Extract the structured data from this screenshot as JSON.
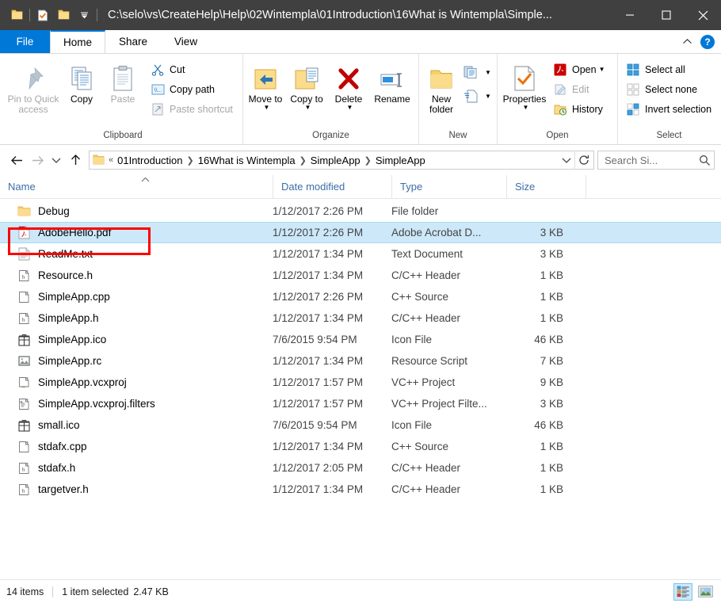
{
  "window": {
    "title": "C:\\selo\\vs\\CreateHelp\\Help\\02Wintempla\\01Introduction\\16What is Wintempla\\Simple...",
    "quick_access": [
      "folder-icon",
      "properties-check-icon",
      "new-folder-icon",
      "chevron-down-icon"
    ],
    "controls": {
      "minimize": "minimize-icon",
      "maximize": "maximize-icon",
      "close": "close-icon"
    }
  },
  "ribbon": {
    "tabs": [
      {
        "label": "File",
        "id": "file"
      },
      {
        "label": "Home",
        "id": "home"
      },
      {
        "label": "Share",
        "id": "share"
      },
      {
        "label": "View",
        "id": "view"
      }
    ],
    "active_tab": "Home",
    "collapse_icon": "chevron-up-icon",
    "help_label": "?",
    "groups": [
      {
        "label": "Clipboard",
        "big_buttons": [
          {
            "label": "Pin to Quick access",
            "icon": "pin-icon",
            "disabled": true
          },
          {
            "label": "Copy",
            "icon": "copy-icon",
            "disabled": false
          },
          {
            "label": "Paste",
            "icon": "paste-icon",
            "disabled": true
          }
        ],
        "small_buttons": [
          {
            "label": "Cut",
            "icon": "scissors-icon",
            "disabled": false
          },
          {
            "label": "Copy path",
            "icon": "copy-path-icon",
            "disabled": false
          },
          {
            "label": "Paste shortcut",
            "icon": "paste-shortcut-icon",
            "disabled": true
          }
        ]
      },
      {
        "label": "Organize",
        "big_buttons": [
          {
            "label": "Move to",
            "icon": "move-to-icon",
            "dropdown": true
          },
          {
            "label": "Copy to",
            "icon": "copy-to-icon",
            "dropdown": true
          },
          {
            "label": "Delete",
            "icon": "delete-x-icon",
            "dropdown": true
          },
          {
            "label": "Rename",
            "icon": "rename-icon",
            "dropdown": false
          }
        ]
      },
      {
        "label": "New",
        "big_buttons": [
          {
            "label": "New folder",
            "icon": "new-folder-icon"
          }
        ],
        "small_buttons": [
          {
            "label": "",
            "icon": "new-item-icon",
            "dropdown": true
          },
          {
            "label": "",
            "icon": "easy-access-icon",
            "dropdown": true
          }
        ]
      },
      {
        "label": "Open",
        "big_buttons": [
          {
            "label": "Properties",
            "icon": "properties-check-icon",
            "dropdown": true
          }
        ],
        "small_buttons": [
          {
            "label": "Open",
            "icon": "adobe-acrobat-icon",
            "dropdown": true,
            "disabled": false
          },
          {
            "label": "Edit",
            "icon": "edit-icon",
            "disabled": true
          },
          {
            "label": "History",
            "icon": "history-icon",
            "disabled": false
          }
        ]
      },
      {
        "label": "Select",
        "small_buttons": [
          {
            "label": "Select all",
            "icon": "select-all-icon"
          },
          {
            "label": "Select none",
            "icon": "select-none-icon"
          },
          {
            "label": "Invert selection",
            "icon": "invert-selection-icon"
          }
        ]
      }
    ]
  },
  "navigation": {
    "back": "back-arrow-icon",
    "forward": "forward-arrow-icon",
    "recent": "chevron-down-icon",
    "up": "up-arrow-icon",
    "breadcrumb_overflow": "«",
    "breadcrumbs": [
      "01Introduction",
      "16What is Wintempla",
      "SimpleApp",
      "SimpleApp"
    ],
    "address_dropdown": "chevron-down-icon",
    "refresh": "refresh-icon",
    "search_placeholder": "Search Si...",
    "search_icon": "search-icon"
  },
  "columns": [
    {
      "label": "Name",
      "sorted": "asc"
    },
    {
      "label": "Date modified"
    },
    {
      "label": "Type"
    },
    {
      "label": "Size"
    }
  ],
  "files": [
    {
      "name": "Debug",
      "date": "1/12/2017 2:26 PM",
      "type": "File folder",
      "size": "",
      "icon": "folder-icon",
      "selected": false
    },
    {
      "name": "AdobeHello.pdf",
      "date": "1/12/2017 2:26 PM",
      "type": "Adobe Acrobat D...",
      "size": "3 KB",
      "icon": "pdf-icon",
      "selected": true
    },
    {
      "name": "ReadMe.txt",
      "date": "1/12/2017 1:34 PM",
      "type": "Text Document",
      "size": "3 KB",
      "icon": "text-icon",
      "selected": false
    },
    {
      "name": "Resource.h",
      "date": "1/12/2017 1:34 PM",
      "type": "C/C++ Header",
      "size": "1 KB",
      "icon": "header-icon",
      "selected": false
    },
    {
      "name": "SimpleApp.cpp",
      "date": "1/12/2017 2:26 PM",
      "type": "C++ Source",
      "size": "1 KB",
      "icon": "cpp-icon",
      "selected": false
    },
    {
      "name": "SimpleApp.h",
      "date": "1/12/2017 1:34 PM",
      "type": "C/C++ Header",
      "size": "1 KB",
      "icon": "header-icon",
      "selected": false
    },
    {
      "name": "SimpleApp.ico",
      "date": "7/6/2015 9:54 PM",
      "type": "Icon File",
      "size": "46 KB",
      "icon": "ico-icon",
      "selected": false
    },
    {
      "name": "SimpleApp.rc",
      "date": "1/12/2017 1:34 PM",
      "type": "Resource Script",
      "size": "7 KB",
      "icon": "rc-icon",
      "selected": false
    },
    {
      "name": "SimpleApp.vcxproj",
      "date": "1/12/2017 1:57 PM",
      "type": "VC++ Project",
      "size": "9 KB",
      "icon": "vcxproj-icon",
      "selected": false
    },
    {
      "name": "SimpleApp.vcxproj.filters",
      "date": "1/12/2017 1:57 PM",
      "type": "VC++ Project Filte...",
      "size": "3 KB",
      "icon": "filters-icon",
      "selected": false
    },
    {
      "name": "small.ico",
      "date": "7/6/2015 9:54 PM",
      "type": "Icon File",
      "size": "46 KB",
      "icon": "ico-icon",
      "selected": false
    },
    {
      "name": "stdafx.cpp",
      "date": "1/12/2017 1:34 PM",
      "type": "C++ Source",
      "size": "1 KB",
      "icon": "cpp-icon",
      "selected": false
    },
    {
      "name": "stdafx.h",
      "date": "1/12/2017 2:05 PM",
      "type": "C/C++ Header",
      "size": "1 KB",
      "icon": "header-icon",
      "selected": false
    },
    {
      "name": "targetver.h",
      "date": "1/12/2017 1:34 PM",
      "type": "C/C++ Header",
      "size": "1 KB",
      "icon": "header-icon",
      "selected": false
    }
  ],
  "status": {
    "item_count": "14 items",
    "selection": "1 item selected",
    "selection_size": "2.47 KB",
    "views": [
      {
        "name": "details-view",
        "active": true
      },
      {
        "name": "large-icons-view",
        "active": false
      }
    ]
  },
  "annotation": {
    "color": "#ff0000",
    "target": "AdobeHello.pdf"
  }
}
